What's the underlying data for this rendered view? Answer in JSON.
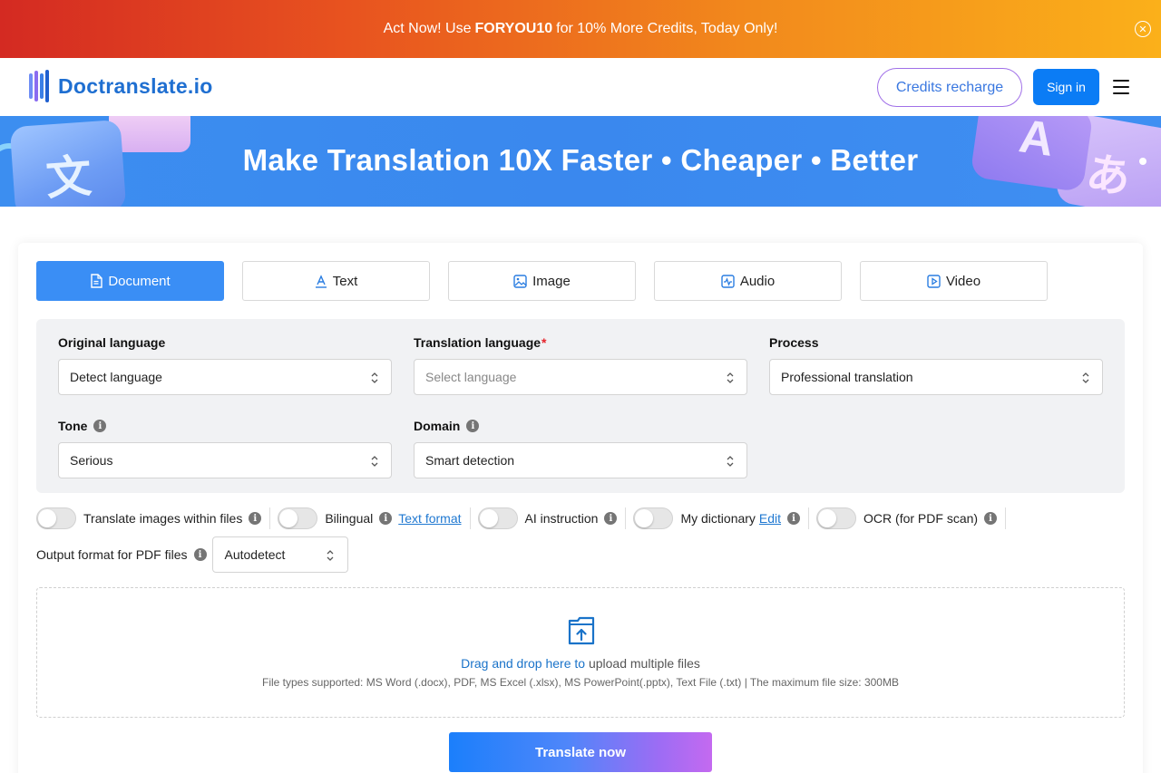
{
  "promo": {
    "text_before": "Act Now! Use",
    "code": "FORYOU10",
    "text_after": "for 10% More Credits, Today Only!",
    "close_glyph": "✕"
  },
  "header": {
    "logo_text": "Doctranslate.io",
    "credits_button": "Credits recharge",
    "signin_button": "Sign in"
  },
  "hero": {
    "title": "Make Translation 10X Faster • Cheaper • Better",
    "deco_glyph_left": "文",
    "deco_glyph_right_a": "A",
    "deco_glyph_right_b": "あ"
  },
  "tabs": [
    {
      "label": "Document",
      "icon": "document-icon",
      "active": true
    },
    {
      "label": "Text",
      "icon": "text-icon",
      "active": false
    },
    {
      "label": "Image",
      "icon": "image-icon",
      "active": false
    },
    {
      "label": "Audio",
      "icon": "audio-icon",
      "active": false
    },
    {
      "label": "Video",
      "icon": "video-icon",
      "active": false
    }
  ],
  "settings": {
    "original_language": {
      "label": "Original language",
      "value": "Detect language"
    },
    "translation_language": {
      "label": "Translation language",
      "required_mark": "*",
      "placeholder": "Select language"
    },
    "process": {
      "label": "Process",
      "value": "Professional translation"
    },
    "tone": {
      "label": "Tone",
      "value": "Serious"
    },
    "domain": {
      "label": "Domain",
      "value": "Smart detection"
    }
  },
  "toggles": {
    "translate_images": "Translate images within files",
    "bilingual": "Bilingual",
    "text_format_link": "Text format",
    "ai_instruction": "AI instruction",
    "my_dictionary": "My dictionary",
    "edit_link": "Edit",
    "ocr": "OCR (for PDF scan)"
  },
  "output": {
    "label": "Output format for PDF files",
    "value": "Autodetect"
  },
  "dropzone": {
    "link_text": "Drag and drop here to",
    "rest_text": "upload multiple files",
    "supported": "File types supported: MS Word (.docx), PDF, MS Excel (.xlsx), MS PowerPoint(.pptx), Text File (.txt) | The maximum file size: 300MB"
  },
  "translate_button": "Translate now",
  "colors": {
    "accent": "#3a8ef5",
    "signin": "#0b7cf5",
    "logo": "#1f6fd1",
    "link": "#1f78d1"
  }
}
